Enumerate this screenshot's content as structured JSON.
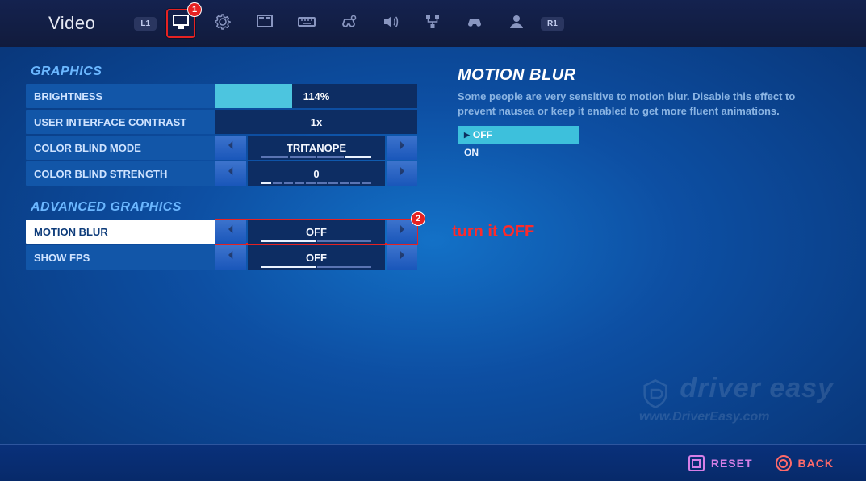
{
  "header": {
    "title": "Video",
    "shoulder_left": "L1",
    "shoulder_right": "R1",
    "tabs": [
      {
        "id": "display",
        "active": true,
        "badge": "1"
      },
      {
        "id": "settings"
      },
      {
        "id": "hud"
      },
      {
        "id": "keyboard"
      },
      {
        "id": "controller-config"
      },
      {
        "id": "audio"
      },
      {
        "id": "network"
      },
      {
        "id": "gamepad"
      },
      {
        "id": "account"
      }
    ]
  },
  "graphics": {
    "section": "GRAPHICS",
    "brightness": {
      "label": "BRIGHTNESS",
      "value": "114%",
      "fill_pct": 38
    },
    "ui_contrast": {
      "label": "USER INTERFACE CONTRAST",
      "value": "1x"
    },
    "color_blind_mode": {
      "label": "COLOR BLIND MODE",
      "value": "TRITANOPE"
    },
    "color_blind_strength": {
      "label": "COLOR BLIND STRENGTH",
      "value": "0"
    }
  },
  "advanced": {
    "section": "ADVANCED GRAPHICS",
    "motion_blur": {
      "label": "MOTION BLUR",
      "value": "OFF",
      "badge": "2"
    },
    "show_fps": {
      "label": "SHOW FPS",
      "value": "OFF"
    }
  },
  "info": {
    "title": "MOTION BLUR",
    "desc": "Some people are very sensitive to motion blur. Disable this effect to prevent nausea or keep it enabled to get more fluent animations.",
    "options": [
      {
        "label": "OFF",
        "active": true
      },
      {
        "label": "ON",
        "active": false
      }
    ]
  },
  "annotation": "turn it OFF",
  "footer": {
    "reset": "RESET",
    "back": "BACK"
  },
  "watermark": {
    "line1": "driver easy",
    "line2": "www.DriverEasy.com"
  }
}
